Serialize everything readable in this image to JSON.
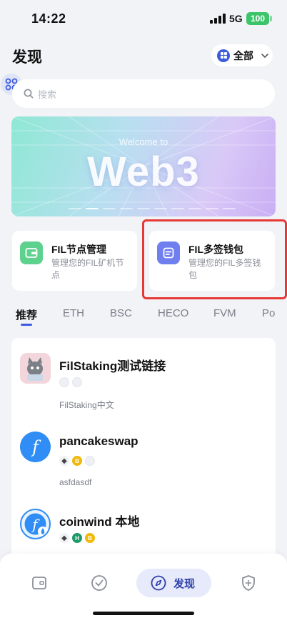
{
  "status_bar": {
    "time": "14:22",
    "network": "5G",
    "battery": "100"
  },
  "header": {
    "title": "发现",
    "filter_label": "全部"
  },
  "search": {
    "placeholder": "搜索"
  },
  "banner": {
    "subtitle": "Welcome to",
    "title": "Web3"
  },
  "quick_cards": [
    {
      "title": "FIL节点管理",
      "desc": "管理您的FIL矿机节点",
      "icon": "wallet-icon",
      "color": "#5fd18f"
    },
    {
      "title": "FIL多签钱包",
      "desc": "管理您的FIL多签钱包",
      "icon": "multisig-icon",
      "color": "#6f7ff0"
    }
  ],
  "tabs": [
    "推荐",
    "ETH",
    "BSC",
    "HECO",
    "FVM",
    "Po"
  ],
  "active_tab": "推荐",
  "dapps": [
    {
      "name": "FilStaking测试链接",
      "desc": "FilStaking中文",
      "chains": [
        "ghost",
        "ghost"
      ]
    },
    {
      "name": "pancakeswap",
      "desc": "asfdasdf",
      "chains": [
        "eth",
        "bsc",
        "ghost"
      ]
    },
    {
      "name": "coinwind 本地",
      "desc": "",
      "chains": [
        "eth",
        "heco",
        "bsc"
      ]
    }
  ],
  "bottom_nav": {
    "active_label": "发现",
    "items": [
      "wallet-icon",
      "check-icon",
      "compass-icon",
      "shield-icon"
    ]
  },
  "colors": {
    "accent": "#3d5be0",
    "highlight": "#e53935",
    "bsc": "#f0b90b",
    "heco": "#1f9b6a"
  }
}
